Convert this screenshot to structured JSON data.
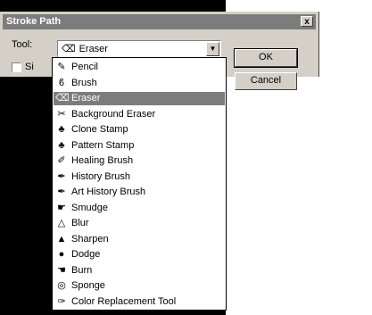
{
  "dialog": {
    "title": "Stroke Path",
    "close_label": "x",
    "tool_label": "Tool:",
    "selected_tool": "Eraser",
    "simulate_label": "Si",
    "ok_label": "OK",
    "cancel_label": "Cancel"
  },
  "dropdown": {
    "items": [
      {
        "label": "Pencil",
        "icon": "pencil-icon"
      },
      {
        "label": "Brush",
        "icon": "brush-icon"
      },
      {
        "label": "Eraser",
        "icon": "eraser-icon",
        "selected": true
      },
      {
        "label": "Background Eraser",
        "icon": "background-eraser-icon"
      },
      {
        "label": "Clone Stamp",
        "icon": "clone-stamp-icon"
      },
      {
        "label": "Pattern Stamp",
        "icon": "pattern-stamp-icon"
      },
      {
        "label": "Healing Brush",
        "icon": "healing-brush-icon"
      },
      {
        "label": "History Brush",
        "icon": "history-brush-icon"
      },
      {
        "label": "Art History Brush",
        "icon": "art-history-brush-icon"
      },
      {
        "label": "Smudge",
        "icon": "smudge-icon"
      },
      {
        "label": "Blur",
        "icon": "blur-icon"
      },
      {
        "label": "Sharpen",
        "icon": "sharpen-icon"
      },
      {
        "label": "Dodge",
        "icon": "dodge-icon"
      },
      {
        "label": "Burn",
        "icon": "burn-icon"
      },
      {
        "label": "Sponge",
        "icon": "sponge-icon"
      },
      {
        "label": "Color Replacement Tool",
        "icon": "color-replacement-icon"
      }
    ]
  },
  "colors": {
    "dialog_bg": "#d4d0c8",
    "selection": "#7c7c7c"
  }
}
